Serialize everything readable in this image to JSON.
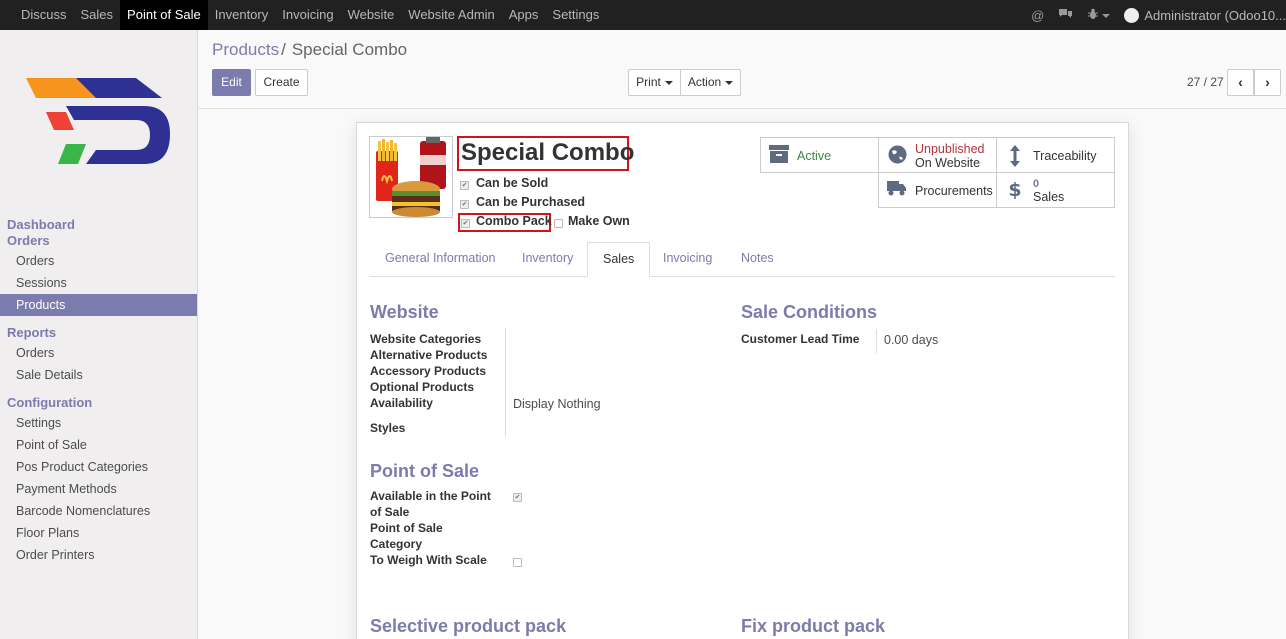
{
  "topbar": {
    "menu": [
      "Discuss",
      "Sales",
      "Point of Sale",
      "Inventory",
      "Invoicing",
      "Website",
      "Website Admin",
      "Apps",
      "Settings"
    ],
    "active_index": 2,
    "user": "Administrator (Odoo10..."
  },
  "sidebar": {
    "sections": [
      {
        "title": "Dashboard"
      },
      {
        "title": "Orders",
        "items": [
          "Orders",
          "Sessions",
          "Products"
        ]
      },
      {
        "title": "Reports",
        "items": [
          "Orders",
          "Sale Details"
        ]
      },
      {
        "title": "Configuration",
        "items": [
          "Settings",
          "Point of Sale",
          "Pos Product Categories",
          "Payment Methods",
          "Barcode Nomenclatures",
          "Floor Plans",
          "Order Printers"
        ]
      }
    ],
    "active_item": "Products"
  },
  "breadcrumb": {
    "parent": "Products",
    "separator": "/",
    "current": "Special Combo"
  },
  "buttons": {
    "edit": "Edit",
    "create": "Create",
    "print": "Print",
    "action": "Action"
  },
  "pager": {
    "value": "27 / 27"
  },
  "product": {
    "name": "Special Combo",
    "flags": [
      {
        "label": "Can be Sold",
        "checked": true
      },
      {
        "label": "Can be Purchased",
        "checked": true
      },
      {
        "label": "Combo Pack",
        "checked": true
      },
      {
        "label": "Make Own",
        "checked": false
      }
    ]
  },
  "smart_buttons": {
    "active": "Active",
    "unpublished": "Unpublished",
    "on_website": "On Website",
    "traceability": "Traceability",
    "procurements": "Procurements",
    "sales_count": "0",
    "sales_label": "Sales"
  },
  "tabs": [
    "General Information",
    "Inventory",
    "Sales",
    "Invoicing",
    "Notes"
  ],
  "active_tab": "Sales",
  "website": {
    "title": "Website",
    "fields": [
      "Website Categories",
      "Alternative Products",
      "Accessory Products",
      "Optional Products",
      "Availability",
      "Styles"
    ],
    "availability_value": "Display Nothing"
  },
  "sale_conditions": {
    "title": "Sale Conditions",
    "lead_time_label": "Customer Lead Time",
    "lead_time_value": "0.00 days"
  },
  "point_of_sale": {
    "title": "Point of Sale",
    "available_label_1": "Available in the Point",
    "available_label_2": "of Sale",
    "available": true,
    "category_label_1": "Point of Sale",
    "category_label_2": "Category",
    "weigh_label": "To Weigh With Scale",
    "weigh": false
  },
  "packs": {
    "selective": "Selective product pack",
    "fixed": "Fix product pack"
  },
  "colors": {
    "accent": "#7c7bad",
    "highlight": "#d0141c",
    "topbar": "#212121",
    "unpublished": "#b0363b",
    "active": "#3b8a4a"
  }
}
